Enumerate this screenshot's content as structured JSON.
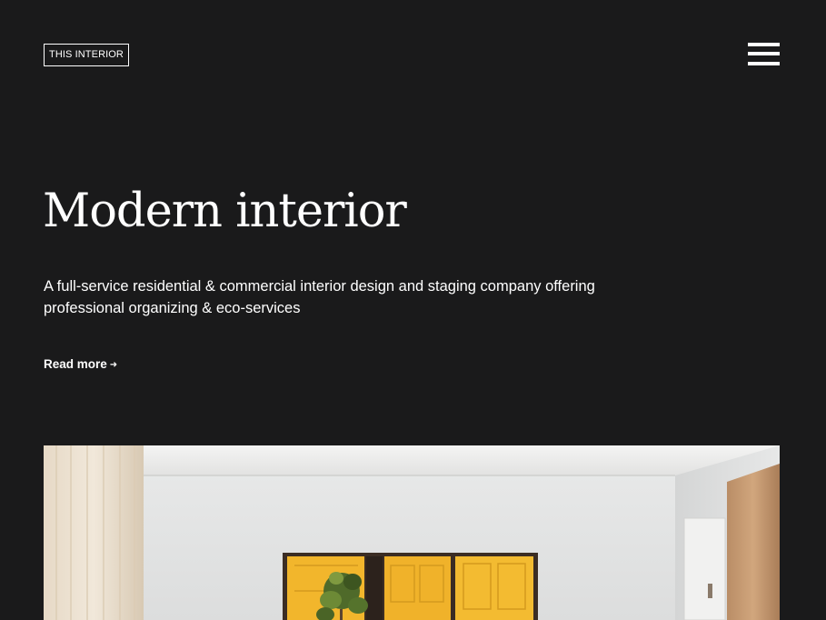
{
  "header": {
    "logo_text": "THIS INTERIOR",
    "menu_icon": "hamburger-menu-icon"
  },
  "hero": {
    "title": "Modern interior",
    "description": "A full-service residential & commercial interior design and staging company offering professional organizing & eco-services",
    "read_more_label": "Read more",
    "read_more_icon": "arrow-right-icon"
  },
  "colors": {
    "background": "#1a1a1b",
    "text": "#ffffff",
    "accent_yellow": "#f2b62c"
  }
}
